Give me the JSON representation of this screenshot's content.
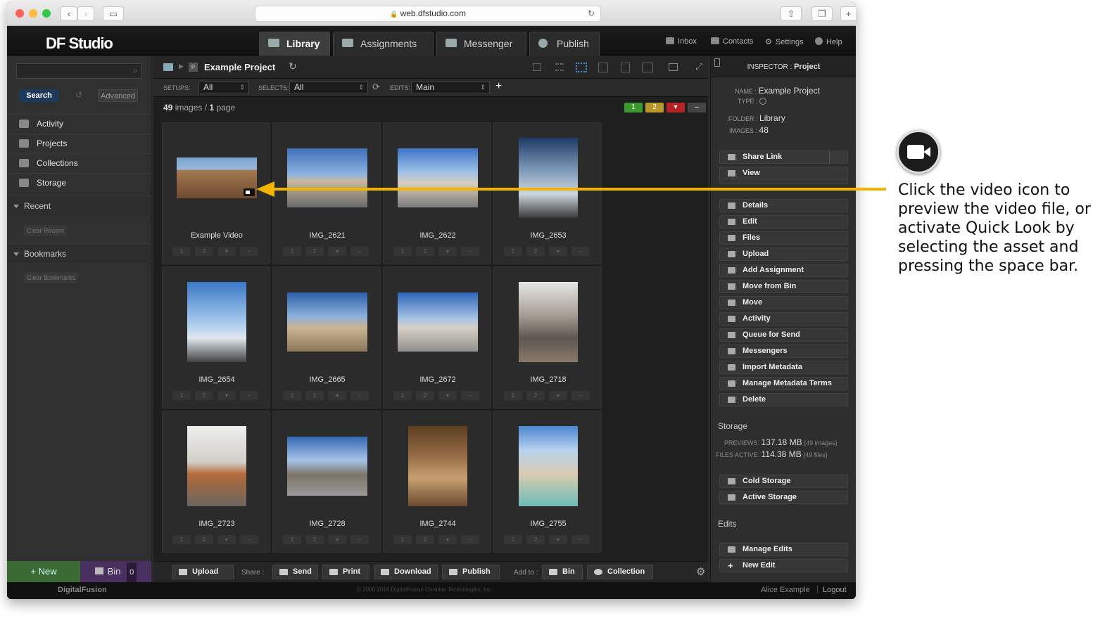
{
  "browser": {
    "url": "web.dfstudio.com"
  },
  "app": {
    "logo": "DF Studio",
    "tabs": [
      {
        "label": "Library",
        "active": true,
        "icon": "library-icon"
      },
      {
        "label": "Assignments",
        "active": false,
        "icon": "assignment-icon"
      },
      {
        "label": "Messenger",
        "active": false,
        "icon": "messenger-icon"
      },
      {
        "label": "Publish",
        "active": false,
        "icon": "publish-icon"
      }
    ],
    "header_links": [
      "Inbox",
      "Contacts",
      "Settings",
      "Help"
    ]
  },
  "sidebar": {
    "search_button": "Search",
    "advanced_button": "Advanced",
    "nav": [
      "Activity",
      "Projects",
      "Collections",
      "Storage"
    ],
    "recent_label": "Recent",
    "clear_recent": "Clear Recent",
    "bookmarks_label": "Bookmarks",
    "clear_bookmarks": "Clear Bookmarks",
    "new_button": "+ New",
    "bin_label": "Bin",
    "bin_count": "0"
  },
  "project": {
    "title": "Example Project",
    "setups_label": "SETUPS:",
    "setups_value": "All",
    "selects_label": "SELECTS:",
    "selects_value": "All",
    "edits_label": "EDITS:",
    "edits_value": "Main",
    "image_count": "49",
    "images_word": "images",
    "page_count": "1",
    "page_word": "page",
    "rating_badges": [
      "1",
      "2"
    ]
  },
  "grid": [
    {
      "name": "Example Video"
    },
    {
      "name": "IMG_2621"
    },
    {
      "name": "IMG_2622"
    },
    {
      "name": "IMG_2653"
    },
    {
      "name": "IMG_2654"
    },
    {
      "name": "IMG_2665"
    },
    {
      "name": "IMG_2672"
    },
    {
      "name": "IMG_2718"
    },
    {
      "name": "IMG_2723"
    },
    {
      "name": "IMG_2728"
    },
    {
      "name": "IMG_2744"
    },
    {
      "name": "IMG_2755"
    }
  ],
  "cell_rating": [
    "1",
    "2"
  ],
  "bottom_bar": {
    "upload": "Upload",
    "share_label": "Share :",
    "send": "Send",
    "print": "Print",
    "download": "Download",
    "publish": "Publish",
    "add_to_label": "Add to :",
    "bin": "Bin",
    "collection": "Collection"
  },
  "inspector": {
    "title_prefix": "INSPECTOR :",
    "title": "Project",
    "name_label": "NAME :",
    "name_value": "Example Project",
    "type_label": "TYPE :",
    "folder_label": "FOLDER :",
    "folder_value": "Library",
    "images_label": "IMAGES :",
    "images_value": "48",
    "actions": [
      "Share Link",
      "View",
      "Details",
      "Edit",
      "Files",
      "Upload",
      "Add Assignment",
      "Move from Bin",
      "Move",
      "Activity",
      "Queue for Send",
      "Messengers",
      "Import Metadata",
      "Manage Metadata Terms",
      "Delete"
    ],
    "storage_heading": "Storage",
    "previews_label": "PREVIEWS:",
    "previews_value": "137.18 MB",
    "previews_note": "(49 images)",
    "files_label": "FILES ACTIVE:",
    "files_value": "114.38 MB",
    "files_note": "(49 files)",
    "storage_actions": [
      "Cold Storage",
      "Active Storage"
    ],
    "edits_heading": "Edits",
    "edit_actions": [
      "Manage Edits",
      "New Edit"
    ]
  },
  "footer": {
    "brand": "DigitalFusion",
    "copyright": "© 2000-2018 DigitalFusion Creative Technologies, Inc.",
    "user": "Alice Example",
    "logout": "Logout"
  },
  "annotation": {
    "text": "Click the video icon to preview the video file, or activate Quick Look by selecting the asset and pressing the space bar.",
    "colors": {
      "arrow": "#f3b400"
    }
  }
}
